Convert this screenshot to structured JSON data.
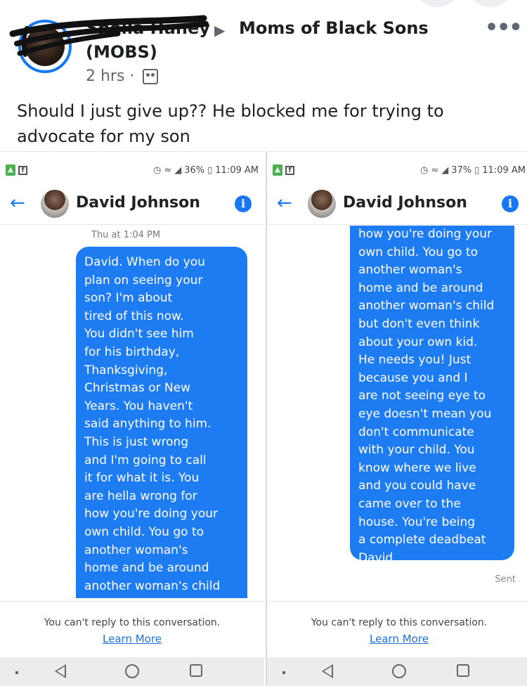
{
  "post": {
    "poster_name": "Sheila Haney",
    "group_name": "Moms of Black Sons",
    "group_abbrev": "(MOBS)",
    "time": "2 hrs ·",
    "text": "Should I just give up?? He blocked me for trying to advocate for my son",
    "icons": {
      "more": "more-dots-icon",
      "audience": "group-audience-icon",
      "arrow": "arrow-right-icon"
    },
    "accent": "#1877f2"
  },
  "panels": [
    {
      "status": {
        "battery": "36%",
        "time": "11:09 AM"
      },
      "contact_name": "David Johnson",
      "timestamp": "Thu at 1:04 PM",
      "message": "David. When do you\nplan on seeing your\nson? I'm about\ntired of this now.\nYou didn't see him\nfor his birthday,\nThanksgiving,\nChristmas or New\nYears. You haven't\nsaid anything to him.\nThis is just wrong\nand I'm going to call\nit for what it is. You\nare hella wrong for\nhow you're doing your\nown child. You go to\nanother woman's\nhome and be around\nanother woman's child\nbut don't even think",
      "reply_notice": "You can't reply to this conversation.",
      "learn_more": "Learn More"
    },
    {
      "status": {
        "battery": "37%",
        "time": "11:09 AM"
      },
      "contact_name": "David Johnson",
      "message": "how you're doing your\nown child. You go to\nanother woman's\nhome and be around\nanother woman's child\nbut don't even think\nabout your own kid.\nHe needs you! Just\nbecause you and I\nare not seeing eye to\neye doesn't mean you\ndon't communicate\nwith your child. You\nknow where we live\nand you could have\ncame over to the\nhouse. You're being\na complete deadbeat\nDavid",
      "sent_label": "Sent",
      "reply_notice": "You can't reply to this conversation.",
      "learn_more": "Learn More"
    }
  ],
  "colors": {
    "bubble": "#1e7cf2",
    "link": "#1e6fd9",
    "nav_bar": "#ececec"
  }
}
